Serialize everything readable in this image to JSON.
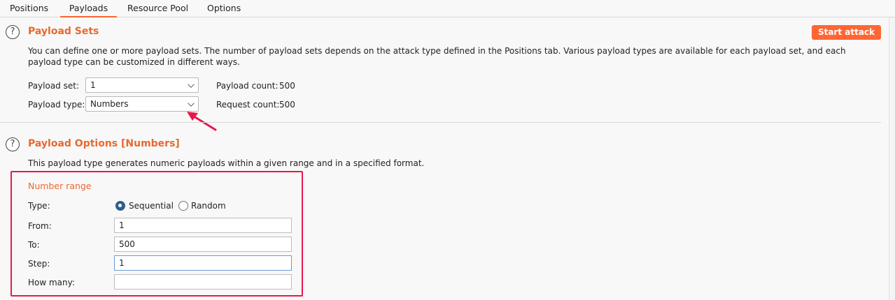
{
  "tabs": [
    "Positions",
    "Payloads",
    "Resource Pool",
    "Options"
  ],
  "active_tab": "Payloads",
  "accent_color": "#ff6633",
  "highlight_color": "#e8174b",
  "payload_sets": {
    "help_icon": "?",
    "title": "Payload Sets",
    "start_attack_label": "Start attack",
    "description": "You can define one or more payload sets. The number of payload sets depends on the attack type defined in the Positions tab. Various payload types are available for each payload set, and each payload type can be customized in different ways.",
    "payload_set_label": "Payload set:",
    "payload_set_value": "1",
    "payload_type_label": "Payload type:",
    "payload_type_value": "Numbers",
    "payload_count_label": "Payload count:",
    "payload_count_value": "500",
    "request_count_label": "Request count:",
    "request_count_value": "500"
  },
  "payload_options": {
    "help_icon": "?",
    "title": "Payload Options [Numbers]",
    "description": "This payload type generates numeric payloads within a given range and in a specified format.",
    "number_range_title": "Number range",
    "type_label": "Type:",
    "type_options": [
      "Sequential",
      "Random"
    ],
    "type_selected": "Sequential",
    "from_label": "From:",
    "from_value": "1",
    "to_label": "To:",
    "to_value": "500",
    "step_label": "Step:",
    "step_value": "1",
    "how_many_label": "How many:",
    "how_many_value": ""
  }
}
